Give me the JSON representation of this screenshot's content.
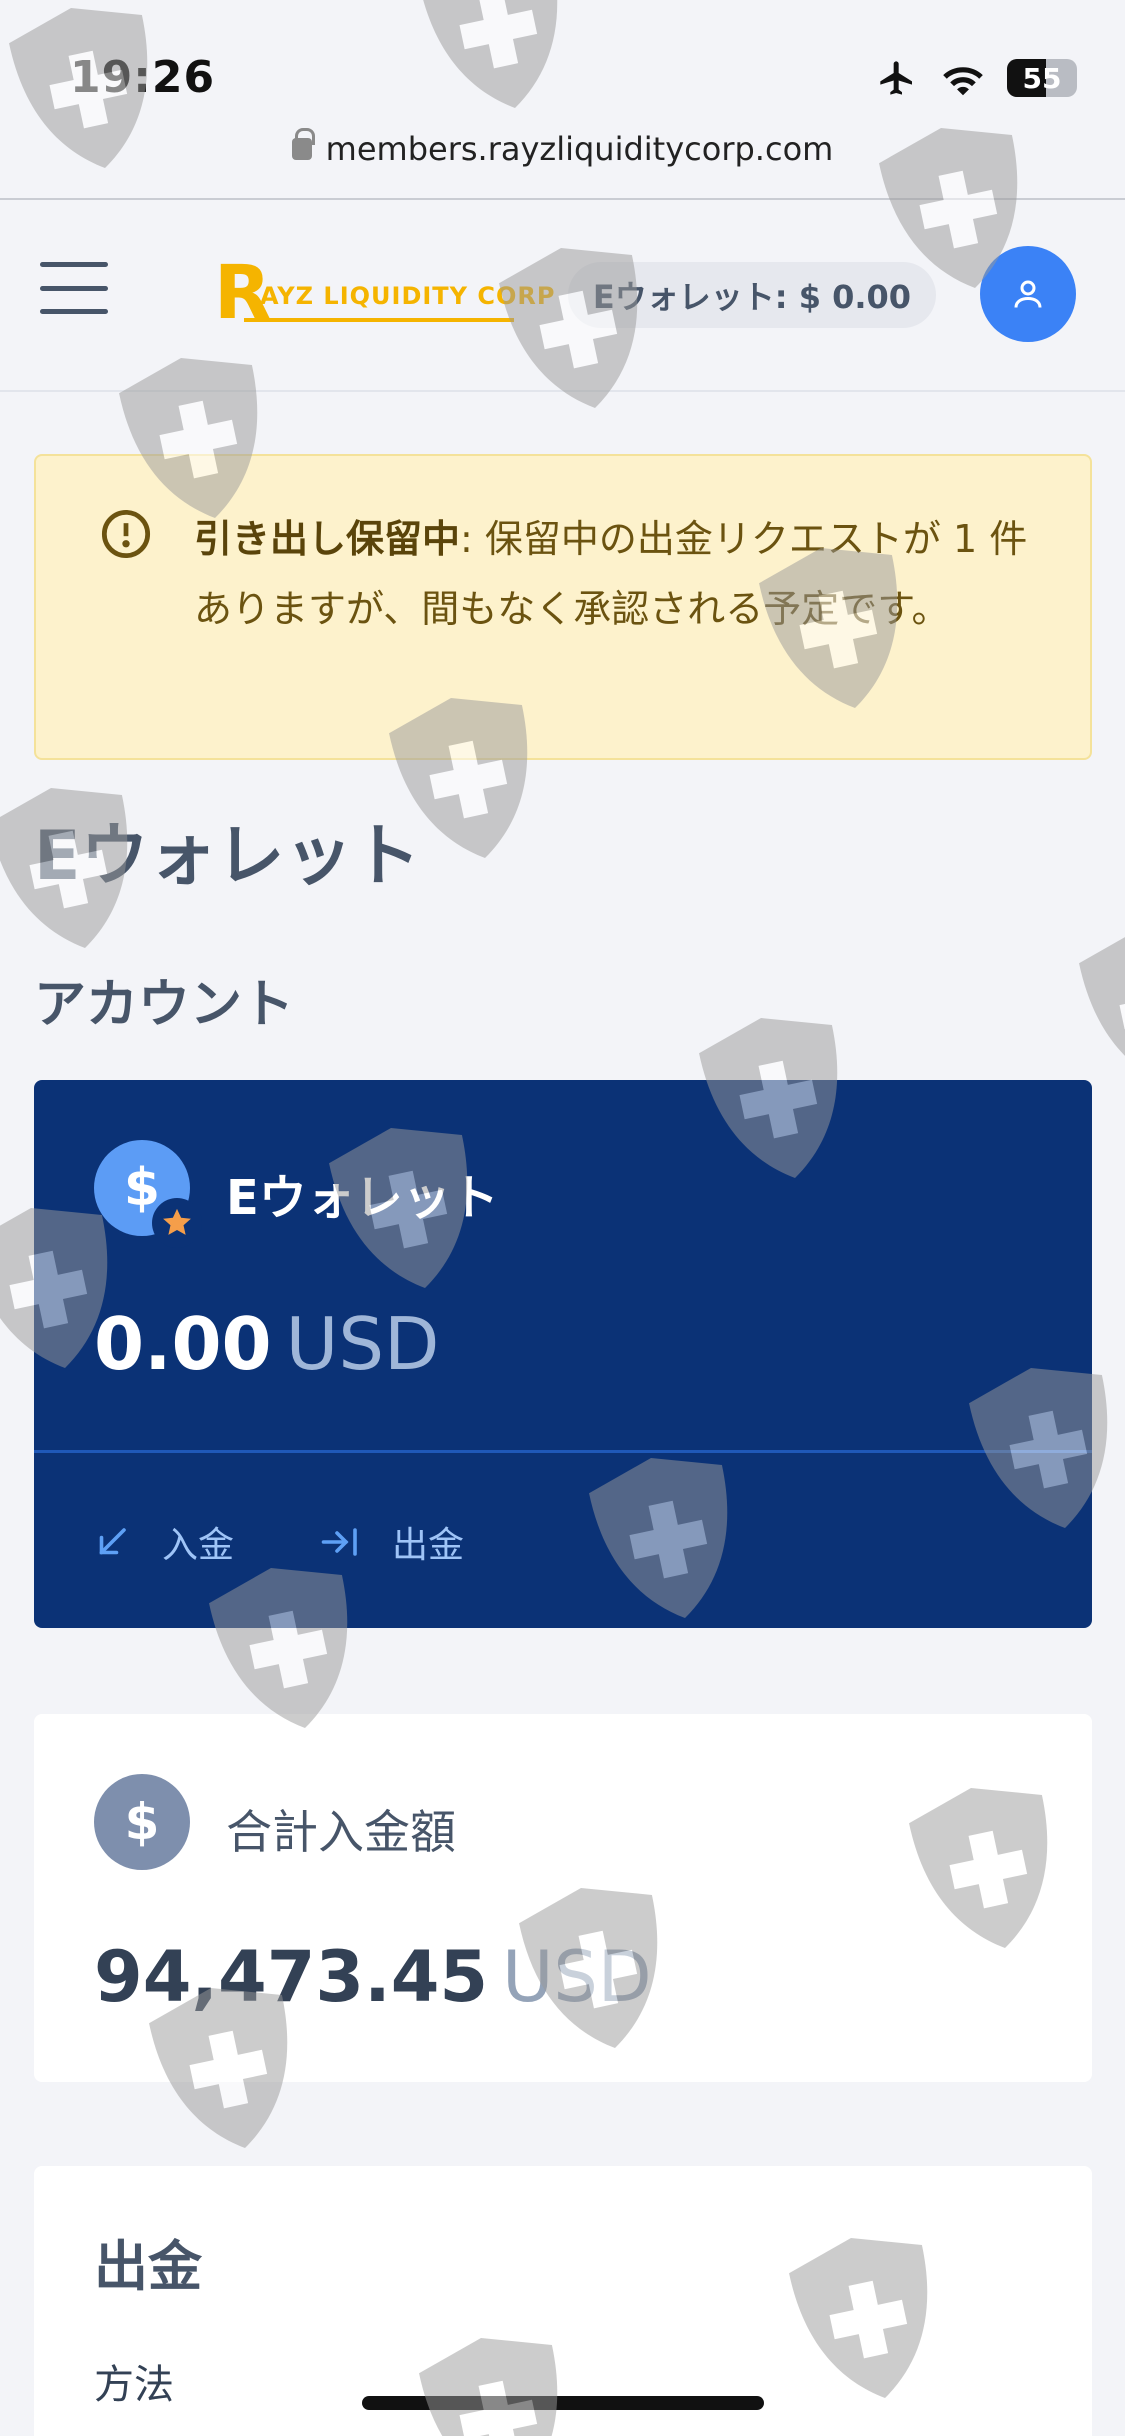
{
  "status_bar": {
    "time": "19:26",
    "battery": "55"
  },
  "browser": {
    "url": "members.rayzliquiditycorp.com"
  },
  "header": {
    "logo_letter": "R",
    "logo_text": "AYZ LIQUIDITY CORP",
    "wallet_pill": "Eウォレット: $ 0.00"
  },
  "alert": {
    "title": "引き出し保留中",
    "message": ": 保留中の出金リクエストが 1 件ありますが、間もなく承認される予定です。"
  },
  "page": {
    "title": "Eウォレット",
    "section": "アカウント"
  },
  "ewallet_card": {
    "name": "Eウォレット",
    "coin_symbol": "$",
    "balance": "0.00",
    "currency": "USD",
    "deposit_label": "入金",
    "withdraw_label": "出金"
  },
  "total_card": {
    "label": "合計入金額",
    "coin_symbol": "$",
    "value": "94,473.45",
    "currency": "USD"
  },
  "withdraw_card": {
    "title": "出金",
    "method_label": "方法"
  },
  "colors": {
    "background": "#f3f4f8",
    "card_dark": "#0b3276",
    "accent_blue": "#3b82f6",
    "logo": "#f5b400",
    "alert_bg": "#fdf2cc"
  },
  "icons": [
    "airplane-icon",
    "wifi-icon",
    "battery-icon",
    "lock-icon",
    "hamburger-icon",
    "user-icon",
    "exclamation-circle-icon",
    "dollar-icon",
    "star-icon",
    "arrow-down-left-icon",
    "arrow-right-bar-icon",
    "shield-watermark-icon"
  ]
}
